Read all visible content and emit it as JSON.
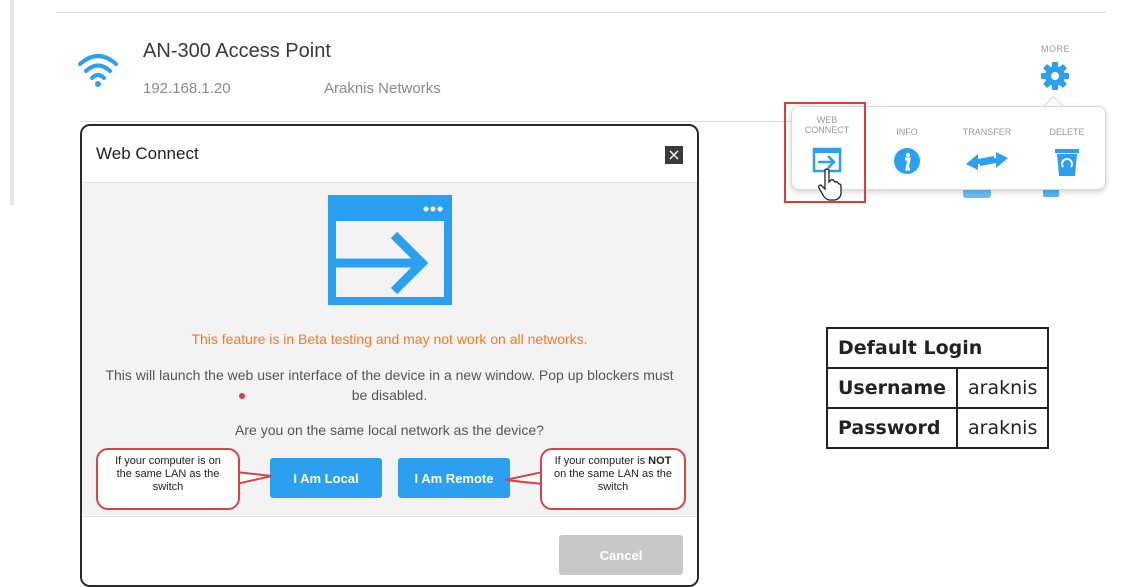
{
  "device": {
    "name": "AN-300 Access Point",
    "ip": "192.168.1.20",
    "vendor": "Araknis Networks"
  },
  "more_label": "MORE",
  "actions": {
    "web_connect": "WEB CONNECT",
    "info": "INFO",
    "transfer": "TRANSFER",
    "delete": "DELETE"
  },
  "modal": {
    "title": "Web Connect",
    "beta_notice": "This feature is in Beta testing and may not work on all networks.",
    "launch_notice": "This will launch the web user interface of the device in a new window. Pop up blockers must be disabled.",
    "question": "Are you on the same local network as the device?",
    "local_button": "I Am Local",
    "remote_button": "I Am Remote",
    "cancel_button": "Cancel"
  },
  "callouts": {
    "local": "If your computer is on the same LAN as the switch",
    "remote_before": "If your computer is",
    "remote_not": "NOT",
    "remote_after": "on the same LAN as the switch"
  },
  "login": {
    "header": "Default Login",
    "username_label": "Username",
    "username_value": "araknis",
    "password_label": "Password",
    "password_value": "araknis"
  },
  "colors": {
    "accent_blue": "#2ba0f0",
    "beta_orange": "#f07b2a",
    "highlight_red": "#e23a3a"
  }
}
